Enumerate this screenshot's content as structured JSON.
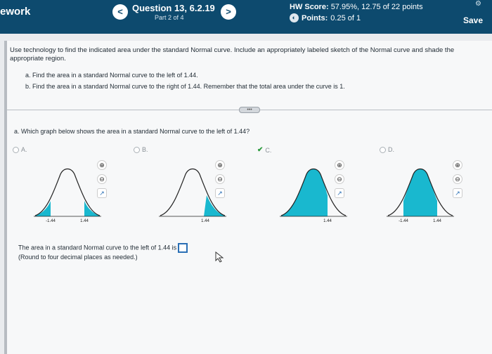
{
  "header": {
    "app_name": "ework",
    "prev_icon": "chevron-left-icon",
    "prev_symbol": "<",
    "next_icon": "chevron-right-icon",
    "next_symbol": ">",
    "question_title": "Question 13, 6.2.19",
    "part": "Part 2 of 4",
    "hw_score_label": "HW Score:",
    "hw_score_value": "57.95%, 12.75 of 22 points",
    "points_label": "Points:",
    "points_value": "0.25 of 1",
    "save_label": "Save"
  },
  "instructions": "Use technology to find the indicated area under the standard Normal curve. Include an appropriately labeled sketch of the Normal curve and shade the appropriate region.",
  "subquestions": [
    "a. Find the area in a standard Normal curve to the left of 1.44.",
    "b. Find the area in a standard Normal curve to the right of 1.44. Remember that the total area under the curve is 1."
  ],
  "more_label": "•••",
  "question": "a. Which graph below shows the area in a standard Normal curve to the left of 1.44?",
  "options": [
    {
      "label": "A.",
      "selected": false,
      "ticks": [
        "-1.44",
        "1.44"
      ]
    },
    {
      "label": "B.",
      "selected": false,
      "ticks": [
        "1.44"
      ]
    },
    {
      "label": "C.",
      "selected": true,
      "ticks": [
        "1.44"
      ]
    },
    {
      "label": "D.",
      "selected": false,
      "ticks": [
        "-1.44",
        "1.44"
      ]
    }
  ],
  "check_symbol": "✔",
  "zoom_in": "⊕",
  "zoom_out": "⊖",
  "external": "↗",
  "answer_text": "The area in a standard Normal curve to the left of 1.44 is",
  "answer_hint": "(Round to four decimal places as needed.)",
  "colors": {
    "header": "#0d4a6e",
    "shade": "#19b8cf",
    "link": "#2a6fb5"
  }
}
